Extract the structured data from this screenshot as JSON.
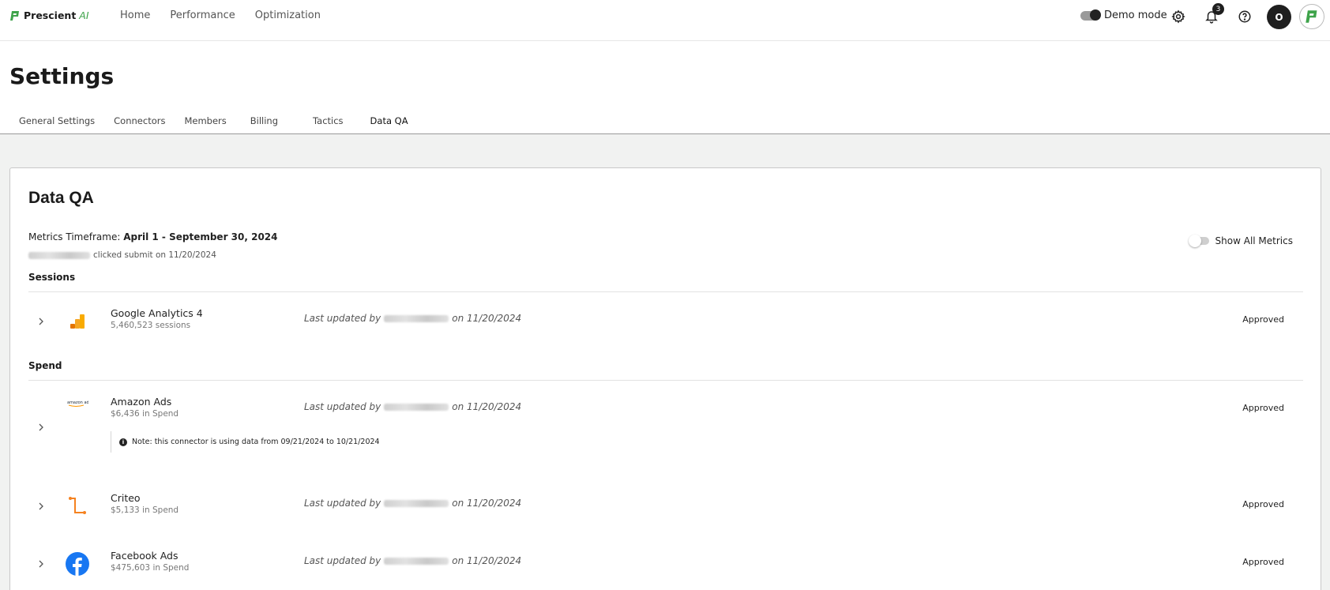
{
  "brand": {
    "name": "Prescient",
    "suffix": "AI"
  },
  "nav": {
    "items": [
      "Home",
      "Performance",
      "Optimization"
    ]
  },
  "toolbar": {
    "demo_label": "Demo mode",
    "notification_count": "3",
    "avatar_initial": "O"
  },
  "page": {
    "title": "Settings"
  },
  "tabs": [
    "General Settings",
    "Connectors",
    "Members",
    "Billing",
    "Tactics",
    "Data QA"
  ],
  "active_tab": "Data QA",
  "card": {
    "title": "Data QA",
    "timeframe_label": "Metrics Timeframe:",
    "timeframe_value": "April 1 - September 30, 2024",
    "submit_text": "clicked submit on 11/20/2024",
    "show_all_label": "Show All Metrics"
  },
  "sections": {
    "sessions": {
      "label": "Sessions",
      "rows": [
        {
          "name": "Google Analytics 4",
          "sub": "5,460,523 sessions",
          "updated_prefix": "Last updated by",
          "updated_suffix": "on 11/20/2024",
          "status": "Approved",
          "icon": "google-analytics-icon"
        }
      ]
    },
    "spend": {
      "label": "Spend",
      "rows": [
        {
          "name": "Amazon Ads",
          "sub": "$6,436 in Spend",
          "updated_prefix": "Last updated by",
          "updated_suffix": "on 11/20/2024",
          "status": "Approved",
          "icon": "amazon-ads-icon",
          "note": "Note: this connector is using data from 09/21/2024 to 10/21/2024"
        },
        {
          "name": "Criteo",
          "sub": "$5,133 in Spend",
          "updated_prefix": "Last updated by",
          "updated_suffix": "on 11/20/2024",
          "status": "Approved",
          "icon": "criteo-icon"
        },
        {
          "name": "Facebook Ads",
          "sub": "$475,603 in Spend",
          "updated_prefix": "Last updated by",
          "updated_suffix": "on 11/20/2024",
          "status": "Approved",
          "icon": "facebook-icon"
        }
      ]
    }
  },
  "colors": {
    "accent": "#3ea34a",
    "background": "#f1f2f1",
    "ga_orange": "#f9ab00",
    "criteo_orange": "#f58220",
    "facebook_blue": "#1877f2"
  }
}
